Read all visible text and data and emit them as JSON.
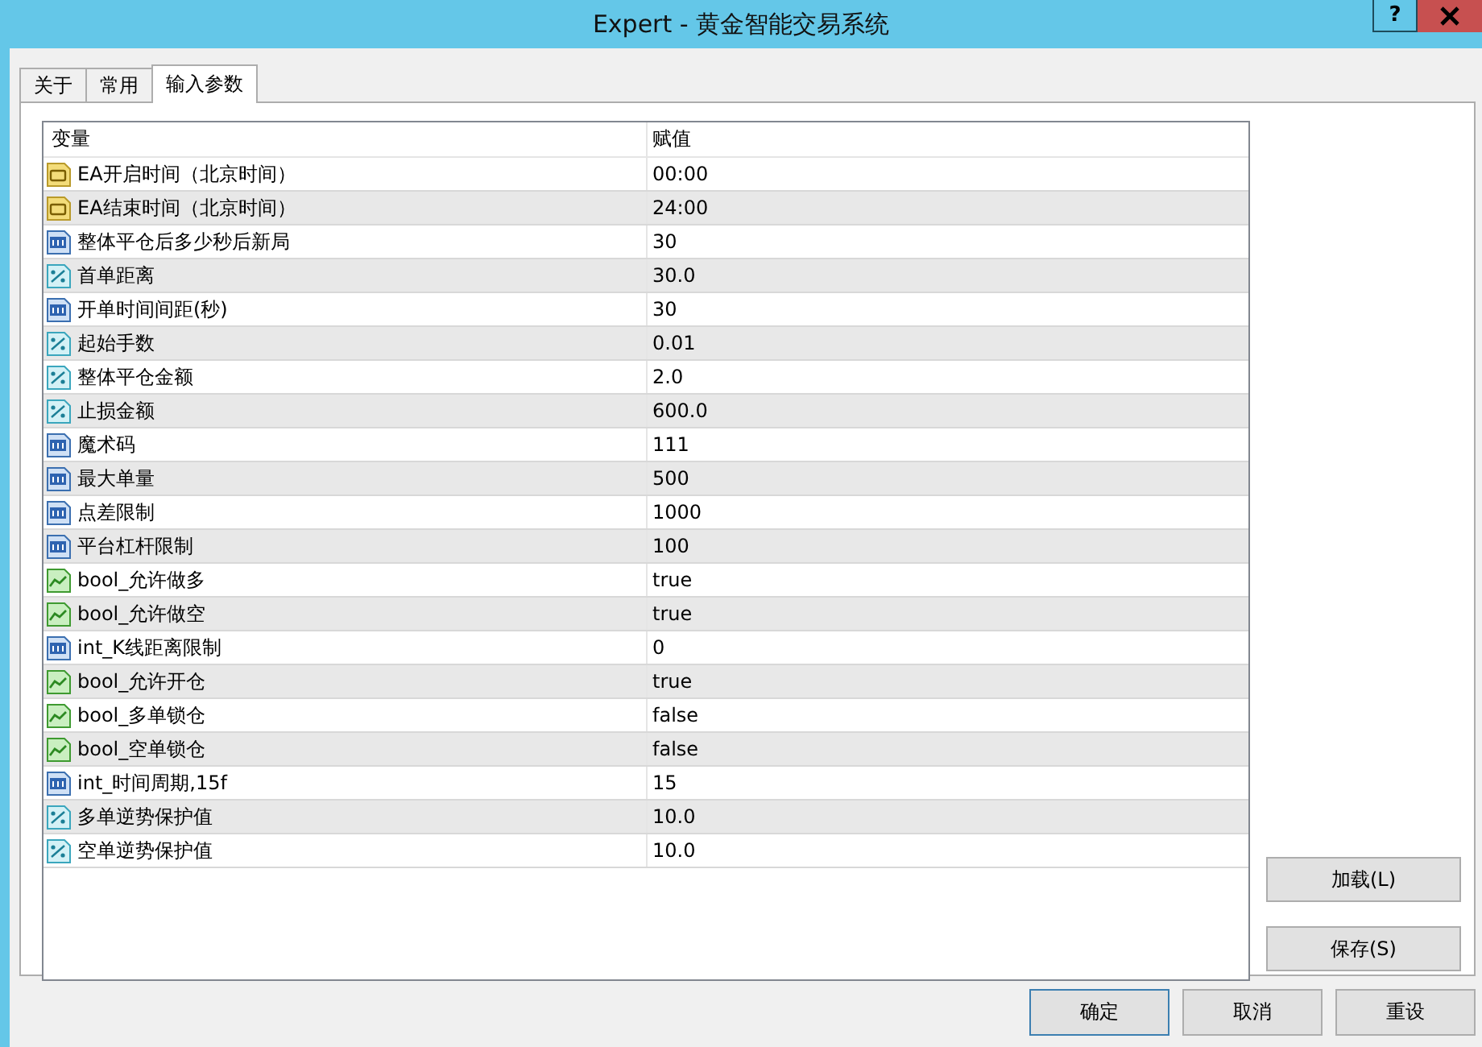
{
  "window": {
    "title": "Expert - 黄金智能交易系统",
    "help_button": "?"
  },
  "tabs": [
    {
      "label": "关于",
      "selected": false
    },
    {
      "label": "常用",
      "selected": false
    },
    {
      "label": "输入参数",
      "selected": true
    }
  ],
  "table": {
    "columns": [
      "变量",
      "赋值"
    ],
    "rows": [
      {
        "kind": "string",
        "name": "EA开启时间（北京时间）",
        "value": "00:00"
      },
      {
        "kind": "string",
        "name": "EA结束时间（北京时间）",
        "value": "24:00"
      },
      {
        "kind": "int",
        "name": "整体平仓后多少秒后新局",
        "value": "30"
      },
      {
        "kind": "double",
        "name": "首单距离",
        "value": "30.0"
      },
      {
        "kind": "int",
        "name": "开单时间间距(秒)",
        "value": "30"
      },
      {
        "kind": "double",
        "name": "起始手数",
        "value": "0.01"
      },
      {
        "kind": "double",
        "name": "整体平仓金额",
        "value": "2.0"
      },
      {
        "kind": "double",
        "name": "止损金额",
        "value": "600.0"
      },
      {
        "kind": "int",
        "name": "魔术码",
        "value": "111"
      },
      {
        "kind": "int",
        "name": "最大单量",
        "value": "500"
      },
      {
        "kind": "int",
        "name": "点差限制",
        "value": "1000"
      },
      {
        "kind": "int",
        "name": "平台杠杆限制",
        "value": "100"
      },
      {
        "kind": "bool",
        "name": "bool_允许做多",
        "value": "true"
      },
      {
        "kind": "bool",
        "name": "bool_允许做空",
        "value": "true"
      },
      {
        "kind": "int",
        "name": "int_K线距离限制",
        "value": "0"
      },
      {
        "kind": "bool",
        "name": "bool_允许开仓",
        "value": "true"
      },
      {
        "kind": "bool",
        "name": "bool_多单锁仓",
        "value": "false"
      },
      {
        "kind": "bool",
        "name": "bool_空单锁仓",
        "value": "false"
      },
      {
        "kind": "int",
        "name": "int_时间周期,15f",
        "value": "15"
      },
      {
        "kind": "double",
        "name": "多单逆势保护值",
        "value": "10.0"
      },
      {
        "kind": "double",
        "name": "空单逆势保护值",
        "value": "10.0"
      }
    ]
  },
  "side_buttons": [
    "加载(L)",
    "保存(S)"
  ],
  "bottom_buttons": [
    "确定",
    "取消",
    "重设"
  ]
}
